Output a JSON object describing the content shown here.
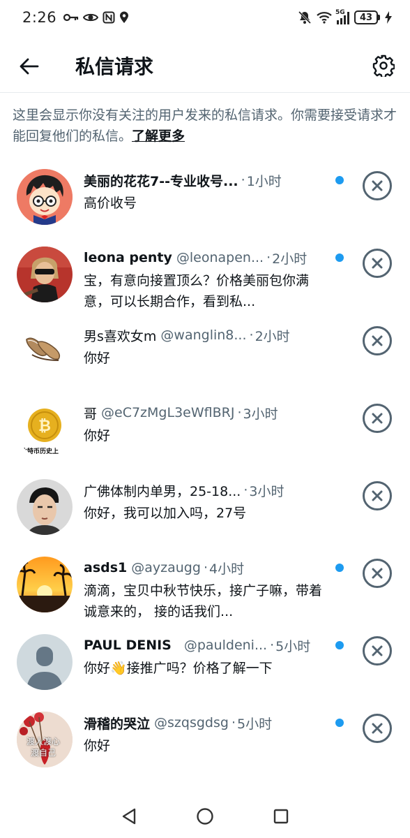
{
  "status_bar": {
    "time": "2:26",
    "battery": "43",
    "network": "5G"
  },
  "header": {
    "title": "私信请求"
  },
  "notice": {
    "text": "这里会显示你没有关注的用户发来的私信请求。你需要接受请求才能回复他们的私信。",
    "link": "了解更多"
  },
  "requests": [
    {
      "name": "美丽的花花7--专业收号...",
      "handle": "",
      "time": "1小时",
      "message": "高价收号",
      "unread": true,
      "avatar": "cartoon-boy-glasses"
    },
    {
      "name": "leona penty",
      "handle": "@leonapen...",
      "time": "2小时",
      "message": "宝，有意向接置顶么？价格美丽包你满意，可以长期合作，看到私...",
      "unread": true,
      "avatar": "singer-sunglasses"
    },
    {
      "name": "男s喜欢女m",
      "handle": "@wanglin8...",
      "time": "2小时",
      "message": "你好",
      "unread": false,
      "avatar": "loafer-shoes"
    },
    {
      "name": "哥",
      "handle": "@eC7zMgL3eWflBRJ",
      "time": "3小时",
      "message": "你好",
      "unread": false,
      "avatar": "bitcoin-coin"
    },
    {
      "name": "广佛体制内单男，25-18...",
      "handle": "",
      "time": "3小时",
      "message": "你好，我可以加入吗，27号",
      "unread": false,
      "avatar": "young-man-photo"
    },
    {
      "name": "asds1",
      "handle": "@ayzaugg",
      "time": "4小时",
      "message": "滴滴，宝贝中秋节快乐，接广子嘛，带着诚意来的， 接的话我们...",
      "unread": true,
      "avatar": "sunset-palms"
    },
    {
      "name": "PAUL DENIS",
      "handle": "@pauldeni...",
      "time": "5小时",
      "message": "你好👋接推广吗？价格了解一下",
      "unread": true,
      "avatar": "default-person"
    },
    {
      "name": "滑稽的哭泣",
      "handle": "@szqsgdsg",
      "time": "5小时",
      "message": "你好",
      "unread": true,
      "avatar": "red-flowers-text"
    }
  ],
  "avatar_texts": {
    "bitcoin_caption": "比特币历史上",
    "flower_line1": "渡人渡心",
    "flower_line2": "渡自己"
  },
  "colors": {
    "accent_blue": "#1d9bf0",
    "secondary_text": "#536471",
    "primary_text": "#0f1419"
  }
}
